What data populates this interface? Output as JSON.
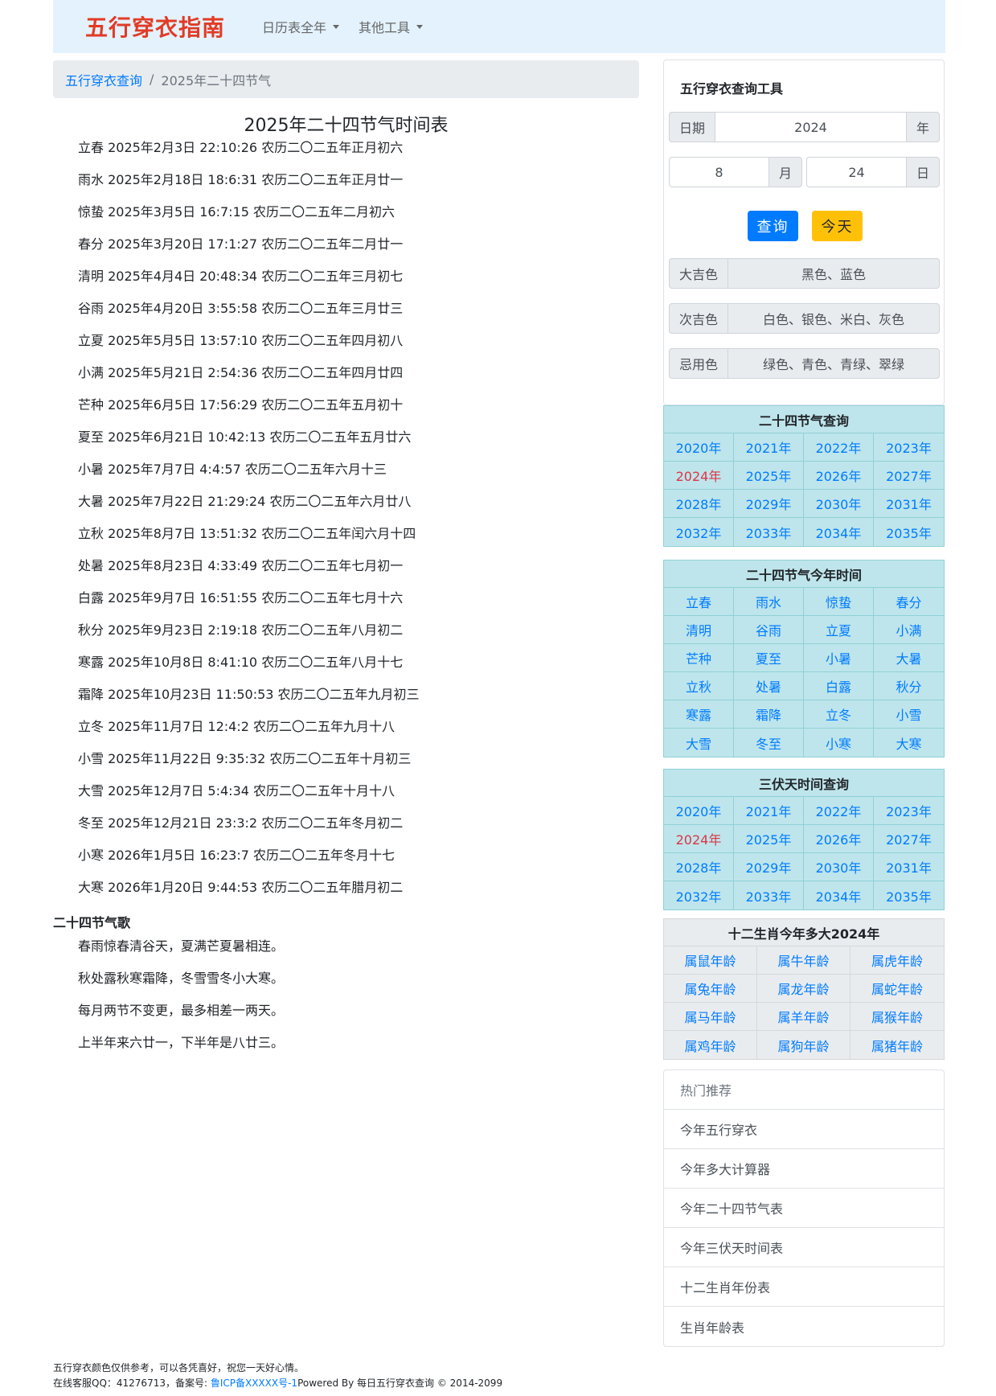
{
  "navbar": {
    "brand": "五行穿衣指南",
    "menu": [
      {
        "label": "日历表全年"
      },
      {
        "label": "其他工具"
      }
    ]
  },
  "breadcrumb": {
    "home": "五行穿衣查询",
    "separator": "/",
    "current": "2025年二十四节气"
  },
  "main": {
    "title": "2025年二十四节气时间表",
    "terms": [
      "立春 2025年2月3日 22:10:26 农历二〇二五年正月初六",
      "雨水 2025年2月18日 18:6:31 农历二〇二五年正月廿一",
      "惊蛰 2025年3月5日 16:7:15 农历二〇二五年二月初六",
      "春分 2025年3月20日 17:1:27 农历二〇二五年二月廿一",
      "清明 2025年4月4日 20:48:34 农历二〇二五年三月初七",
      "谷雨 2025年4月20日 3:55:58 农历二〇二五年三月廿三",
      "立夏 2025年5月5日 13:57:10 农历二〇二五年四月初八",
      "小满 2025年5月21日 2:54:36 农历二〇二五年四月廿四",
      "芒种 2025年6月5日 17:56:29 农历二〇二五年五月初十",
      "夏至 2025年6月21日 10:42:13 农历二〇二五年五月廿六",
      "小暑 2025年7月7日 4:4:57 农历二〇二五年六月十三",
      "大暑 2025年7月22日 21:29:24 农历二〇二五年六月廿八",
      "立秋 2025年8月7日 13:51:32 农历二〇二五年闰六月十四",
      "处暑 2025年8月23日 4:33:49 农历二〇二五年七月初一",
      "白露 2025年9月7日 16:51:55 农历二〇二五年七月十六",
      "秋分 2025年9月23日 2:19:18 农历二〇二五年八月初二",
      "寒露 2025年10月8日 8:41:10 农历二〇二五年八月十七",
      "霜降 2025年10月23日 11:50:53 农历二〇二五年九月初三",
      "立冬 2025年11月7日 12:4:2 农历二〇二五年九月十八",
      "小雪 2025年11月22日 9:35:32 农历二〇二五年十月初三",
      "大雪 2025年12月7日 5:4:34 农历二〇二五年十月十八",
      "冬至 2025年12月21日 23:3:2 农历二〇二五年冬月初二",
      "小寒 2026年1月5日 16:23:7 农历二〇二五年冬月十七",
      "大寒 2026年1月20日 9:44:53 农历二〇二五年腊月初二"
    ],
    "song_title": "二十四节气歌",
    "song": [
      "春雨惊春清谷天，夏满芒夏暑相连。",
      "秋处露秋寒霜降，冬雪雪冬小大寒。",
      "每月两节不变更，最多相差一两天。",
      "上半年来六廿一，下半年是八廿三。"
    ]
  },
  "tool": {
    "title": "五行穿衣查询工具",
    "date_label": "日期",
    "year_value": "2024",
    "year_suffix": "年",
    "month_value": "8",
    "month_suffix": "月",
    "day_value": "24",
    "day_suffix": "日",
    "query_button": "查询",
    "today_button": "今天",
    "colors": [
      {
        "label": "大吉色",
        "value": "黑色、蓝色"
      },
      {
        "label": "次吉色",
        "value": "白色、银色、米白、灰色"
      },
      {
        "label": "忌用色",
        "value": "绿色、青色、青绿、翠绿"
      }
    ]
  },
  "solar_terms_query": {
    "title": "二十四节气查询",
    "years": [
      "2020年",
      "2021年",
      "2022年",
      "2023年",
      "2024年",
      "2025年",
      "2026年",
      "2027年",
      "2028年",
      "2029年",
      "2030年",
      "2031年",
      "2032年",
      "2033年",
      "2034年",
      "2035年"
    ],
    "active": "2024年"
  },
  "terms_this_year": {
    "title": "二十四节气今年时间",
    "items": [
      "立春",
      "雨水",
      "惊蛰",
      "春分",
      "清明",
      "谷雨",
      "立夏",
      "小满",
      "芒种",
      "夏至",
      "小暑",
      "大暑",
      "立秋",
      "处暑",
      "白露",
      "秋分",
      "寒露",
      "霜降",
      "立冬",
      "小雪",
      "大雪",
      "冬至",
      "小寒",
      "大寒"
    ]
  },
  "sanfu_query": {
    "title": "三伏天时间查询",
    "years": [
      "2020年",
      "2021年",
      "2022年",
      "2023年",
      "2024年",
      "2025年",
      "2026年",
      "2027年",
      "2028年",
      "2029年",
      "2030年",
      "2031年",
      "2032年",
      "2033年",
      "2034年",
      "2035年"
    ],
    "active": "2024年"
  },
  "zodiac_age": {
    "title": "十二生肖今年多大2024年",
    "items": [
      "属鼠年龄",
      "属牛年龄",
      "属虎年龄",
      "属兔年龄",
      "属龙年龄",
      "属蛇年龄",
      "属马年龄",
      "属羊年龄",
      "属猴年龄",
      "属鸡年龄",
      "属狗年龄",
      "属猪年龄"
    ]
  },
  "hot": {
    "title": "热门推荐",
    "items": [
      "今年五行穿衣",
      "今年多大计算器",
      "今年二十四节气表",
      "今年三伏天时间表",
      "十二生肖年份表",
      "生肖年龄表"
    ]
  },
  "footer": {
    "line1": "五行穿衣颜色仅供参考，可以各凭喜好，祝您一天好心情。",
    "qq_text": "在线客服QQ：41276713，备案号: ",
    "icp": "鲁ICP备XXXXX号-1",
    "powered": "Powered By 每日五行穿衣查询 © 2014-2099"
  },
  "colors": {
    "brand": "#e23b25",
    "navbar_bg": "#e3f2fd",
    "link": "#007bff",
    "active": "#dc3545",
    "info_bg": "#bee5eb",
    "primary": "#007bff",
    "warning": "#ffc107"
  }
}
